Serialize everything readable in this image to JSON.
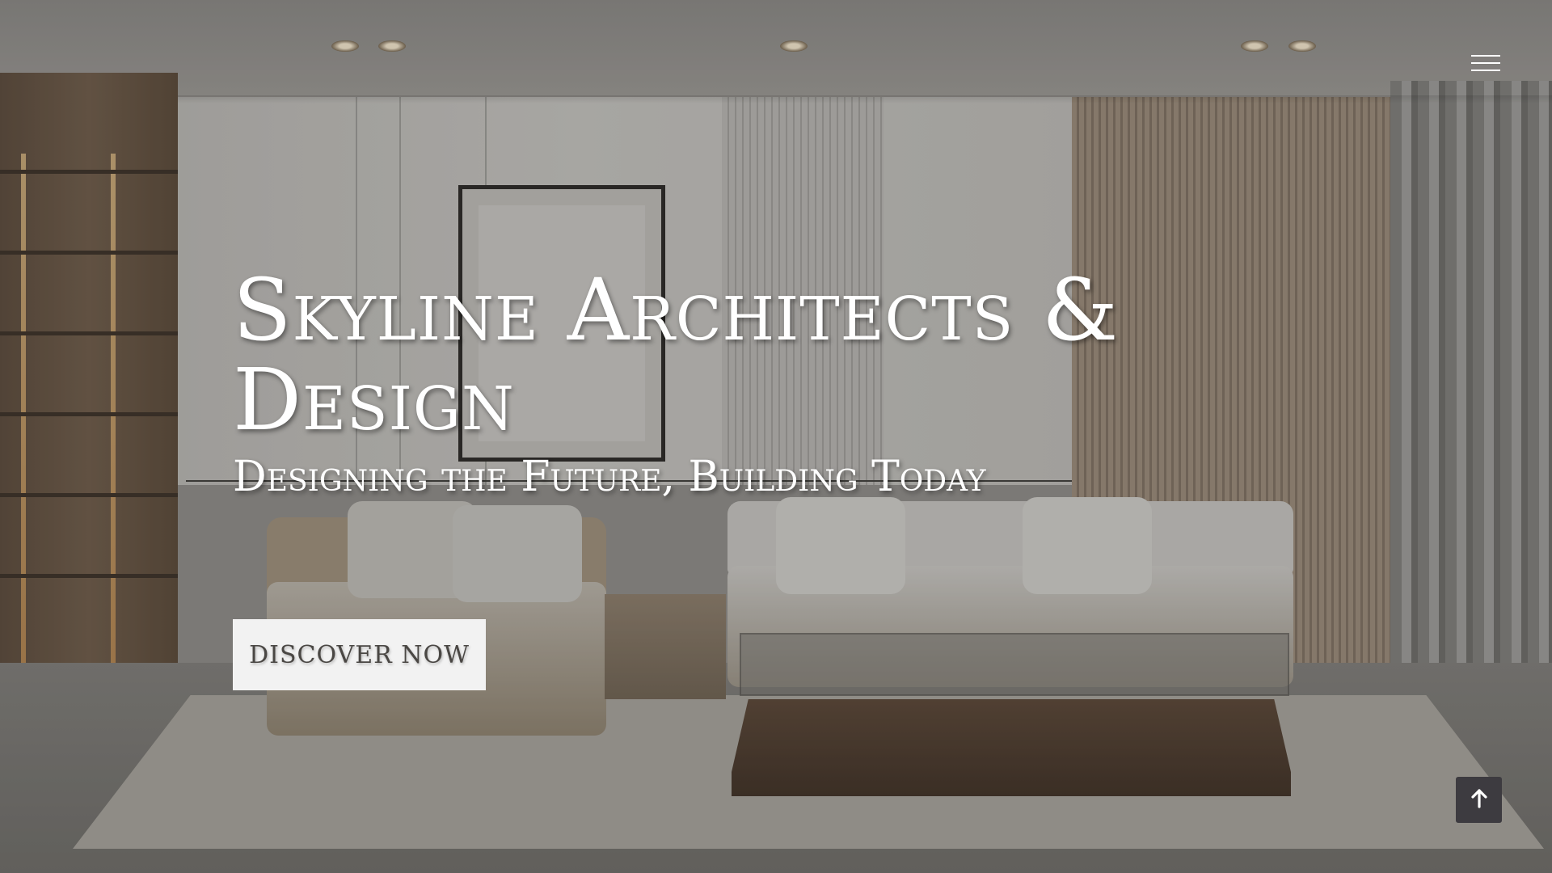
{
  "hero": {
    "title": "Skyline Architects & Design",
    "subtitle": "Designing the Future, Building Today",
    "cta_label": "DISCOVER NOW"
  },
  "nav": {
    "menu_icon": "hamburger-menu-icon"
  },
  "controls": {
    "scroll_top_icon": "arrow-up-icon"
  },
  "colors": {
    "text": "#ffffff",
    "button_bg": "#f2f2f2",
    "button_text": "#4a4744",
    "scroll_button_bg": "#3d3b40"
  }
}
